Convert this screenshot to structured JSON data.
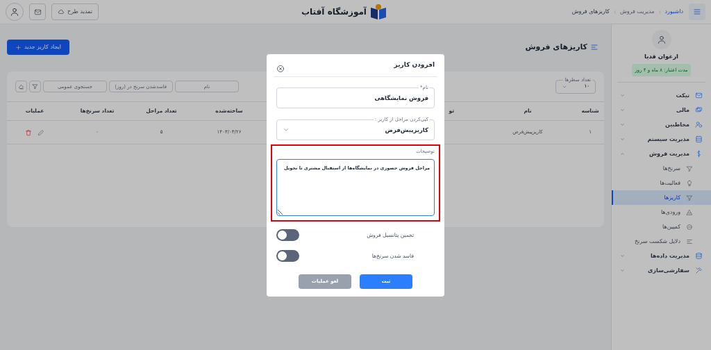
{
  "top_bar": {
    "breadcrumb": [
      "داشبورد",
      "مدیریت فروش",
      "کاریزهای فروش"
    ],
    "logo_text": "آموزشگاه آفتاب",
    "renew_button": "تمدید طرح"
  },
  "sidebar": {
    "user_name": "ارغوان قدیا",
    "validity_badge": "مدت اعتبار: ۸ ماه و ۴ روز",
    "items": [
      {
        "label": "تیکت",
        "expanded": false
      },
      {
        "label": "مالی",
        "expanded": false
      },
      {
        "label": "مخاطبین",
        "expanded": false
      },
      {
        "label": "مدیریت سیستم",
        "expanded": false
      },
      {
        "label": "مدیریت فروش",
        "expanded": true,
        "children": [
          {
            "label": "سرنخ‌ها",
            "selected": false
          },
          {
            "label": "فعالیت‌ها",
            "selected": false
          },
          {
            "label": "کاریزها",
            "selected": true
          },
          {
            "label": "ورودی‌ها",
            "selected": false
          },
          {
            "label": "کمپین‌ها",
            "selected": false
          },
          {
            "label": "دلایل شکست سرنخ",
            "selected": false
          }
        ]
      },
      {
        "label": "مدیریت داده‌ها",
        "expanded": false
      },
      {
        "label": "سفارشی‌سازی",
        "expanded": false
      }
    ]
  },
  "page": {
    "title": "کاریزهای فروش",
    "new_button": "ایجاد کاریز جدید"
  },
  "table": {
    "page_size": {
      "label": "تعداد سطرها",
      "value": "۱۰"
    },
    "filters": [
      {
        "placeholder": "نام"
      },
      {
        "placeholder": "فاسدشدن سرنخ در (روز)"
      },
      {
        "placeholder": "جستجوی عمومی"
      }
    ],
    "columns": [
      "شناسه",
      "نام",
      "تو",
      "ساخته‌شده",
      "تعداد مراحل",
      "تعداد سرنخ‌ها",
      "عملیات"
    ],
    "rows": [
      {
        "id": "۱",
        "name": "کاریزپیش‌فرض",
        "created": "۱۴۰۳/۰۳/۲۶",
        "stages": "۵",
        "leads": "۰"
      }
    ]
  },
  "modal": {
    "title": "افزودن کاریز",
    "name_field": {
      "label": "نام*",
      "value": "فروش نمایشگاهی"
    },
    "copy_field": {
      "label": "کپی‌کردن مراحل از کاریز :",
      "value": "کاریزپیش‌فرض"
    },
    "description": {
      "label": "توضیحات",
      "value": "مراحل فروش حضوری در نمایشگاه‌ها از استقبال مشتری تا تحویل",
      "highlighted": true
    },
    "toggles": [
      {
        "label": "تخمین پتانسیل فروش",
        "on": false
      },
      {
        "label": "فاسد شدن سرنخ‌ها",
        "on": false
      }
    ],
    "submit_button": "ثبت",
    "cancel_button": "لغو عملیات"
  }
}
